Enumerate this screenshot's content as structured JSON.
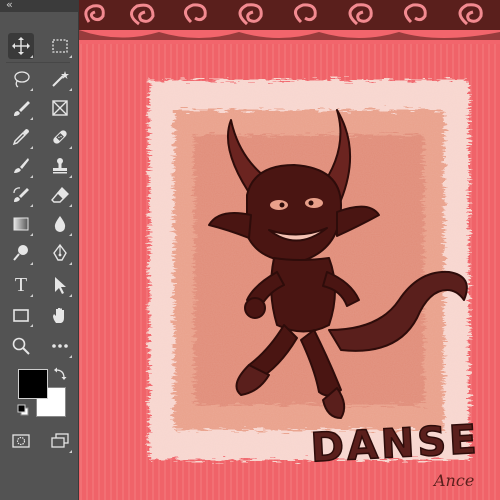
{
  "app": {
    "toolbar_collapse_glyph": "‹‹"
  },
  "toolbar": {
    "tools": [
      {
        "name": "move-tool",
        "icon": "move-icon",
        "active": true
      },
      {
        "name": "marquee-tool",
        "icon": "rectangle-marquee-icon"
      },
      {
        "name": "lasso-tool",
        "icon": "lasso-icon"
      },
      {
        "name": "magic-wand-tool",
        "icon": "magic-wand-icon"
      },
      {
        "name": "brush-tool",
        "icon": "brush-icon"
      },
      {
        "name": "frame-tool",
        "icon": "frame-icon"
      },
      {
        "name": "eyedropper-tool",
        "icon": "eyedropper-icon"
      },
      {
        "name": "healing-brush-tool",
        "icon": "bandage-icon"
      },
      {
        "name": "paint-brush-tool",
        "icon": "paint-brush-icon"
      },
      {
        "name": "clone-stamp-tool",
        "icon": "stamp-icon"
      },
      {
        "name": "history-brush-tool",
        "icon": "history-brush-icon"
      },
      {
        "name": "eraser-tool",
        "icon": "eraser-icon"
      },
      {
        "name": "gradient-tool",
        "icon": "gradient-icon"
      },
      {
        "name": "blur-tool",
        "icon": "drop-icon"
      },
      {
        "name": "dodge-tool",
        "icon": "dodge-icon"
      },
      {
        "name": "pen-tool",
        "icon": "pen-icon"
      },
      {
        "name": "type-tool",
        "icon": "type-icon"
      },
      {
        "name": "path-selection-tool",
        "icon": "arrow-pointer-icon"
      },
      {
        "name": "rectangle-tool",
        "icon": "rectangle-icon"
      },
      {
        "name": "hand-tool",
        "icon": "hand-icon"
      },
      {
        "name": "zoom-tool",
        "icon": "magnifier-icon"
      },
      {
        "name": "more-tools",
        "icon": "ellipsis-icon"
      }
    ],
    "type_tool_glyph": "T",
    "foreground_color": "#000000",
    "background_color": "#ffffff"
  },
  "canvas": {
    "artwork_title": "DANSE",
    "artwork_signature": "Ance",
    "colors": {
      "pink": "#f2656c",
      "border_brown": "#5a1f1c",
      "inner_peach": "#e9a08a",
      "devil_dark": "#4a1512"
    }
  }
}
